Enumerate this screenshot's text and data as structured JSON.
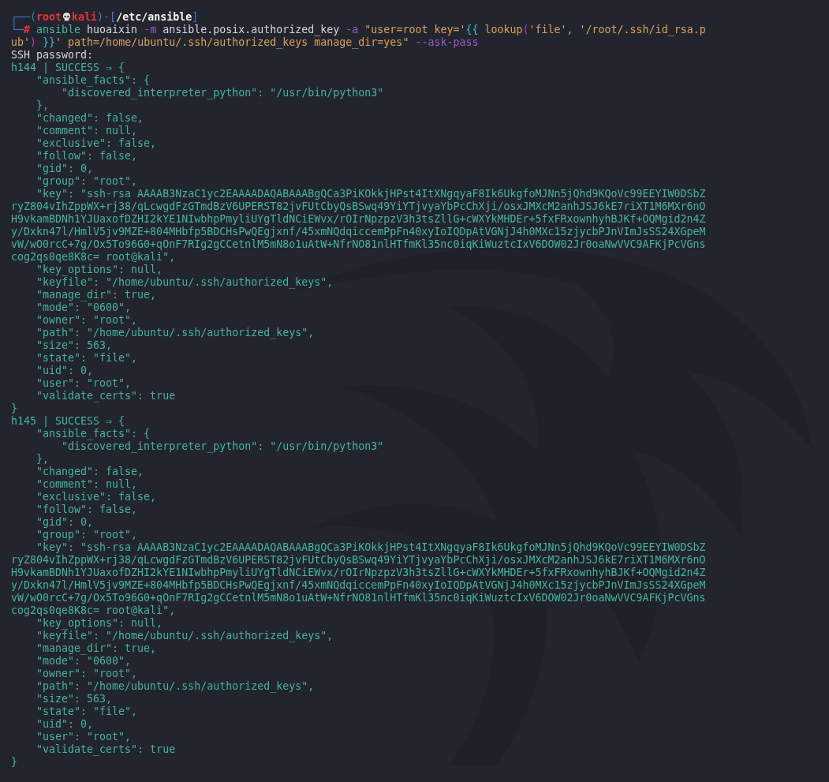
{
  "terminal": {
    "lines": [
      {
        "segments": [
          {
            "text": "┌──(",
            "kind": "box"
          },
          {
            "text": "root",
            "kind": "userhost"
          },
          {
            "kind": "skull"
          },
          {
            "text": "kali",
            "kind": "userhost"
          },
          {
            "text": ")-[",
            "kind": "box"
          },
          {
            "text": "/etc/ansible",
            "kind": "path"
          },
          {
            "text": "]",
            "kind": "box"
          }
        ]
      },
      {
        "segments": [
          {
            "text": "└─",
            "kind": "box"
          },
          {
            "text": "# ",
            "kind": "prompt"
          },
          {
            "text": "ansible",
            "kind": "cmd"
          },
          {
            "text": " huoaixin ",
            "kind": "plain"
          },
          {
            "text": "-m",
            "kind": "flag"
          },
          {
            "text": " ansible.posix.authorized_key ",
            "kind": "plain"
          },
          {
            "text": "-a",
            "kind": "flag"
          },
          {
            "text": " \"user=root key='",
            "kind": "str"
          },
          {
            "text": "{{",
            "kind": "brace"
          },
          {
            "text": " lookup",
            "kind": "str"
          },
          {
            "text": "(",
            "kind": "paren"
          },
          {
            "text": "'file', '/root/.ssh/id_rsa.p",
            "kind": "str"
          }
        ]
      },
      {
        "segments": [
          {
            "text": "ub'",
            "kind": "str"
          },
          {
            "text": ")",
            "kind": "paren"
          },
          {
            "text": " }}",
            "kind": "brace"
          },
          {
            "text": "' path=/home/ubuntu/.ssh/authorized_keys manage_dir=yes\"",
            "kind": "str"
          },
          {
            "text": " --ask-pass",
            "kind": "flag"
          }
        ]
      },
      {
        "segments": [
          {
            "text": "SSH password:",
            "kind": "plain"
          }
        ]
      },
      {
        "segments": [
          {
            "text": "h144 | SUCCESS ⇒ {",
            "kind": "ok"
          }
        ]
      },
      {
        "segments": [
          {
            "text": "    \"ansible_facts\": {",
            "kind": "ok"
          }
        ]
      },
      {
        "segments": [
          {
            "text": "        \"discovered_interpreter_python\": \"/usr/bin/python3\"",
            "kind": "ok"
          }
        ]
      },
      {
        "segments": [
          {
            "text": "    },",
            "kind": "ok"
          }
        ]
      },
      {
        "segments": [
          {
            "text": "    \"changed\": false,",
            "kind": "ok"
          }
        ]
      },
      {
        "segments": [
          {
            "text": "    \"comment\": null,",
            "kind": "ok"
          }
        ]
      },
      {
        "segments": [
          {
            "text": "    \"exclusive\": false,",
            "kind": "ok"
          }
        ]
      },
      {
        "segments": [
          {
            "text": "    \"follow\": false,",
            "kind": "ok"
          }
        ]
      },
      {
        "segments": [
          {
            "text": "    \"gid\": 0,",
            "kind": "ok"
          }
        ]
      },
      {
        "segments": [
          {
            "text": "    \"group\": \"root\",",
            "kind": "ok"
          }
        ]
      },
      {
        "segments": [
          {
            "text": "    \"key\": \"ssh-rsa AAAAB3NzaC1yc2EAAAADAQABAAABgQCa3PiKOkkjHPst4ItXNgqyaF8Ik6UkgfoMJNn5jQhd9KQoVc99EEYIW0DSbZ",
            "kind": "ok"
          }
        ]
      },
      {
        "segments": [
          {
            "text": "ryZ804vIhZppWX+rj38/qLcwgdFzGTmdBzV6UPERST82jvFUtCbyQsBSwq49YiYTjvyaYbPcChXji/osxJMXcM2anhJSJ6kE7riXT1M6MXr6nO",
            "kind": "ok"
          }
        ]
      },
      {
        "segments": [
          {
            "text": "H9vkamBDNh1YJUaxofDZHI2kYE1NIwbhpPmyliUYgTldNCiEWvx/rOIrNpzpzV3h3tsZllG+cWXYkMHDEr+5fxFRxownhyhBJKf+OQMgid2n4Z",
            "kind": "ok"
          }
        ]
      },
      {
        "segments": [
          {
            "text": "y/Dxkn47l/HmlV5jv9MZE+804MHbfp5BDCHsPwQEgjxnf/45xmNQdqiccemPpFn40xyIoIQDpAtVGNjJ4h0MXc15zjycbPJnVImJsSS24XGpeM",
            "kind": "ok"
          }
        ]
      },
      {
        "segments": [
          {
            "text": "vW/wO0rcC+7g/Ox5To96G0+qOnF7RIg2gCCetnlM5mN8o1uAtW+NfrNO81nlHTfmKl35nc0iqKiWuztcIxV6DOW02Jr0oaNwVVC9AFKjPcVGns",
            "kind": "ok"
          }
        ]
      },
      {
        "segments": [
          {
            "text": "cog2qs0qe8K8c= root@kali\",",
            "kind": "ok"
          }
        ]
      },
      {
        "segments": [
          {
            "text": "    \"key_options\": null,",
            "kind": "ok"
          }
        ]
      },
      {
        "segments": [
          {
            "text": "    \"keyfile\": \"/home/ubuntu/.ssh/authorized_keys\",",
            "kind": "ok"
          }
        ]
      },
      {
        "segments": [
          {
            "text": "    \"manage_dir\": true,",
            "kind": "ok"
          }
        ]
      },
      {
        "segments": [
          {
            "text": "    \"mode\": \"0600\",",
            "kind": "ok"
          }
        ]
      },
      {
        "segments": [
          {
            "text": "    \"owner\": \"root\",",
            "kind": "ok"
          }
        ]
      },
      {
        "segments": [
          {
            "text": "    \"path\": \"/home/ubuntu/.ssh/authorized_keys\",",
            "kind": "ok"
          }
        ]
      },
      {
        "segments": [
          {
            "text": "    \"size\": 563,",
            "kind": "ok"
          }
        ]
      },
      {
        "segments": [
          {
            "text": "    \"state\": \"file\",",
            "kind": "ok"
          }
        ]
      },
      {
        "segments": [
          {
            "text": "    \"uid\": 0,",
            "kind": "ok"
          }
        ]
      },
      {
        "segments": [
          {
            "text": "    \"user\": \"root\",",
            "kind": "ok"
          }
        ]
      },
      {
        "segments": [
          {
            "text": "    \"validate_certs\": true",
            "kind": "ok"
          }
        ]
      },
      {
        "segments": [
          {
            "text": "}",
            "kind": "ok"
          }
        ]
      },
      {
        "segments": [
          {
            "text": "h145 | SUCCESS ⇒ {",
            "kind": "ok"
          }
        ]
      },
      {
        "segments": [
          {
            "text": "    \"ansible_facts\": {",
            "kind": "ok"
          }
        ]
      },
      {
        "segments": [
          {
            "text": "        \"discovered_interpreter_python\": \"/usr/bin/python3\"",
            "kind": "ok"
          }
        ]
      },
      {
        "segments": [
          {
            "text": "    },",
            "kind": "ok"
          }
        ]
      },
      {
        "segments": [
          {
            "text": "    \"changed\": false,",
            "kind": "ok"
          }
        ]
      },
      {
        "segments": [
          {
            "text": "    \"comment\": null,",
            "kind": "ok"
          }
        ]
      },
      {
        "segments": [
          {
            "text": "    \"exclusive\": false,",
            "kind": "ok"
          }
        ]
      },
      {
        "segments": [
          {
            "text": "    \"follow\": false,",
            "kind": "ok"
          }
        ]
      },
      {
        "segments": [
          {
            "text": "    \"gid\": 0,",
            "kind": "ok"
          }
        ]
      },
      {
        "segments": [
          {
            "text": "    \"group\": \"root\",",
            "kind": "ok"
          }
        ]
      },
      {
        "segments": [
          {
            "text": "    \"key\": \"ssh-rsa AAAAB3NzaC1yc2EAAAADAQABAAABgQCa3PiKOkkjHPst4ItXNgqyaF8Ik6UkgfoMJNn5jQhd9KQoVc99EEYIW0DSbZ",
            "kind": "ok"
          }
        ]
      },
      {
        "segments": [
          {
            "text": "ryZ804vIhZppWX+rj38/qLcwgdFzGTmdBzV6UPERST82jvFUtCbyQsBSwq49YiYTjvyaYbPcChXji/osxJMXcM2anhJSJ6kE7riXT1M6MXr6nO",
            "kind": "ok"
          }
        ]
      },
      {
        "segments": [
          {
            "text": "H9vkamBDNh1YJUaxofDZHI2kYE1NIwbhpPmyliUYgTldNCiEWvx/rOIrNpzpzV3h3tsZllG+cWXYkMHDEr+5fxFRxownhyhBJKf+OQMgid2n4Z",
            "kind": "ok"
          }
        ]
      },
      {
        "segments": [
          {
            "text": "y/Dxkn47l/HmlV5jv9MZE+804MHbfp5BDCHsPwQEgjxnf/45xmNQdqiccemPpFn40xyIoIQDpAtVGNjJ4h0MXc15zjycbPJnVImJsSS24XGpeM",
            "kind": "ok"
          }
        ]
      },
      {
        "segments": [
          {
            "text": "vW/wO0rcC+7g/Ox5To96G0+qOnF7RIg2gCCetnlM5mN8o1uAtW+NfrNO81nlHTfmKl35nc0iqKiWuztcIxV6DOW02Jr0oaNwVVC9AFKjPcVGns",
            "kind": "ok"
          }
        ]
      },
      {
        "segments": [
          {
            "text": "cog2qs0qe8K8c= root@kali\",",
            "kind": "ok"
          }
        ]
      },
      {
        "segments": [
          {
            "text": "    \"key_options\": null,",
            "kind": "ok"
          }
        ]
      },
      {
        "segments": [
          {
            "text": "    \"keyfile\": \"/home/ubuntu/.ssh/authorized_keys\",",
            "kind": "ok"
          }
        ]
      },
      {
        "segments": [
          {
            "text": "    \"manage_dir\": true,",
            "kind": "ok"
          }
        ]
      },
      {
        "segments": [
          {
            "text": "    \"mode\": \"0600\",",
            "kind": "ok"
          }
        ]
      },
      {
        "segments": [
          {
            "text": "    \"owner\": \"root\",",
            "kind": "ok"
          }
        ]
      },
      {
        "segments": [
          {
            "text": "    \"path\": \"/home/ubuntu/.ssh/authorized_keys\",",
            "kind": "ok"
          }
        ]
      },
      {
        "segments": [
          {
            "text": "    \"size\": 563,",
            "kind": "ok"
          }
        ]
      },
      {
        "segments": [
          {
            "text": "    \"state\": \"file\",",
            "kind": "ok"
          }
        ]
      },
      {
        "segments": [
          {
            "text": "    \"uid\": 0,",
            "kind": "ok"
          }
        ]
      },
      {
        "segments": [
          {
            "text": "    \"user\": \"root\",",
            "kind": "ok"
          }
        ]
      },
      {
        "segments": [
          {
            "text": "    \"validate_certs\": true",
            "kind": "ok"
          }
        ]
      },
      {
        "segments": [
          {
            "text": "}",
            "kind": "ok"
          }
        ]
      }
    ]
  }
}
